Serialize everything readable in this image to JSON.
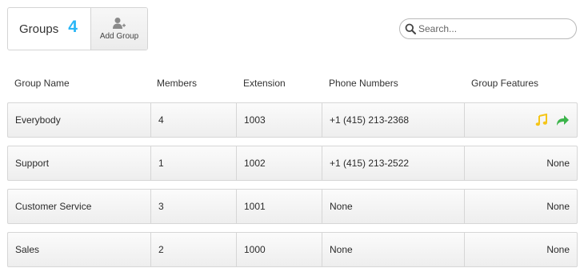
{
  "header": {
    "title": "Groups",
    "count": "4",
    "add_group_label": "Add Group",
    "add_group_icon": "add-user-icon"
  },
  "search": {
    "placeholder": "Search...",
    "value": "",
    "icon": "search-icon"
  },
  "table": {
    "columns": [
      "Group Name",
      "Members",
      "Extension",
      "Phone Numbers",
      "Group Features"
    ],
    "rows": [
      {
        "name": "Everybody",
        "members": "4",
        "extension": "1003",
        "phone": "+1 (415) 213-2368",
        "features": "",
        "feature_icons": [
          "music-note-icon",
          "forward-arrow-icon"
        ]
      },
      {
        "name": "Support",
        "members": "1",
        "extension": "1002",
        "phone": "+1 (415) 213-2522",
        "features": "None",
        "feature_icons": []
      },
      {
        "name": "Customer Service",
        "members": "3",
        "extension": "1001",
        "phone": "None",
        "features": "None",
        "feature_icons": []
      },
      {
        "name": "Sales",
        "members": "2",
        "extension": "1000",
        "phone": "None",
        "features": "None",
        "feature_icons": []
      }
    ]
  },
  "colors": {
    "count_accent": "#29b6f6",
    "music_icon": "#f5c518",
    "forward_icon": "#3cb44b"
  }
}
